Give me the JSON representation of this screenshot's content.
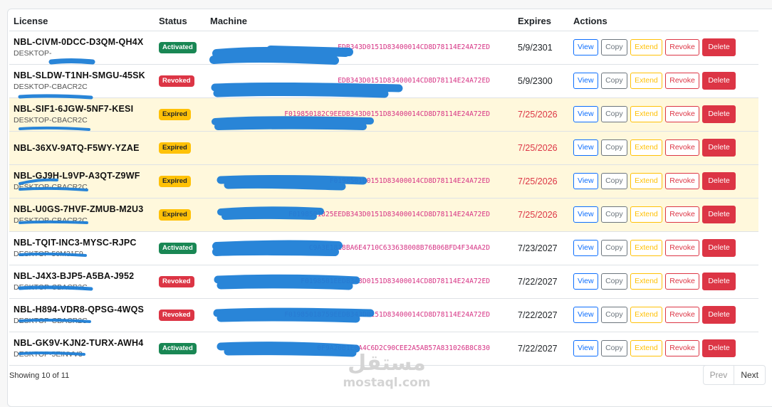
{
  "table": {
    "headers": {
      "license": "License",
      "status": "Status",
      "machine": "Machine",
      "expires": "Expires",
      "actions": "Actions"
    },
    "rows": [
      {
        "code": "NBL-CIVM-0DCC-D3QM-QH4X",
        "desktop": "DESKTOP-",
        "status": "Activated",
        "status_kind": "act",
        "machine": "EDB343D0151D83400014CD8D78114E24A72ED",
        "expires": "5/9/2301",
        "expired": false
      },
      {
        "code": "NBL-SLDW-T1NH-SMGU-45SK",
        "desktop": "DESKTOP-CBACR2C",
        "status": "Revoked",
        "status_kind": "rev",
        "machine": "EDB343D0151D83400014CD8D78114E24A72ED",
        "expires": "5/9/2300",
        "expired": false
      },
      {
        "code": "NBL-SIF1-6JGW-5NF7-KESI",
        "desktop": "DESKTOP-CBACR2C",
        "status": "Expired",
        "status_kind": "exp",
        "machine": "F019850182C9EEDB343D0151D83400014CD8D78114E24A72ED",
        "expires": "7/25/2026",
        "expired": true
      },
      {
        "code": "NBL-36XV-9ATQ-F5WY-YZAE",
        "desktop": "",
        "status": "Expired",
        "status_kind": "exp",
        "machine": "",
        "expires": "7/25/2026",
        "expired": true
      },
      {
        "code": "NBL-GJ9H-L9VP-A3QT-Z9WF",
        "desktop": "DESKTOP-CBACR2C",
        "status": "Expired",
        "status_kind": "exp",
        "machine": "F0198501D0151D83400014CD8D78114E24A72ED",
        "expires": "7/25/2026",
        "expired": true
      },
      {
        "code": "NBL-U0GS-7HVF-ZMUB-M2U3",
        "desktop": "DESKTOP-CBACR2C",
        "status": "Expired",
        "status_kind": "exp",
        "machine": "F0198501825EEDB343D0151D83400014CD8D78114E24A72ED",
        "expires": "7/25/2026",
        "expired": true
      },
      {
        "code": "NBL-TQIT-INC3-MYSC-RJPC",
        "desktop": "DESKTOP-50M31F9",
        "status": "Activated",
        "status_kind": "act",
        "machine": "C9A3E1818BA6E4710C633638008B76B06BFD4F34AA2D",
        "expires": "7/23/2027",
        "expired": false
      },
      {
        "code": "NBL-J4X3-BJP5-A5BA-J952",
        "desktop": "DESKTOP-CBACR2C",
        "status": "Revoked",
        "status_kind": "rev",
        "machine": "F0198501EEDB343D0151D83400014CD8D78114E24A72ED",
        "expires": "7/22/2027",
        "expired": false
      },
      {
        "code": "NBL-H894-VDR8-QPSG-4WQS",
        "desktop": "DESKTOP-CBACR2C",
        "status": "Revoked",
        "status_kind": "rev",
        "machine": "F01985018759EEDB343D0151D83400014CD8D78114E24A72ED",
        "expires": "7/22/2027",
        "expired": false
      },
      {
        "code": "NBL-GK9V-KJN2-TURX-AWH4",
        "desktop": "DESKTOP-5EINVV3",
        "status": "Activated",
        "status_kind": "act",
        "machine": "0F9A20B1E0A4C6D2C90CEE2A5AB57A831026B8C830",
        "expires": "7/22/2027",
        "expired": false
      }
    ],
    "actions": {
      "view": "View",
      "copy": "Copy",
      "extend": "Extend",
      "revoke": "Revoke",
      "delete": "Delete"
    }
  },
  "footer": {
    "showing": "Showing 10 of 11",
    "prev": "Prev",
    "next": "Next"
  },
  "watermark": {
    "arabic": "مستقل",
    "latin": "mostaql.com"
  },
  "colors": {
    "activated": "#198754",
    "revoked": "#dc3545",
    "expired": "#ffc107",
    "expired_row_bg": "#fff8dc",
    "link_blue": "#0d6efd",
    "machine_pink": "#d63384",
    "scribble_blue": "#1e7ed6"
  }
}
